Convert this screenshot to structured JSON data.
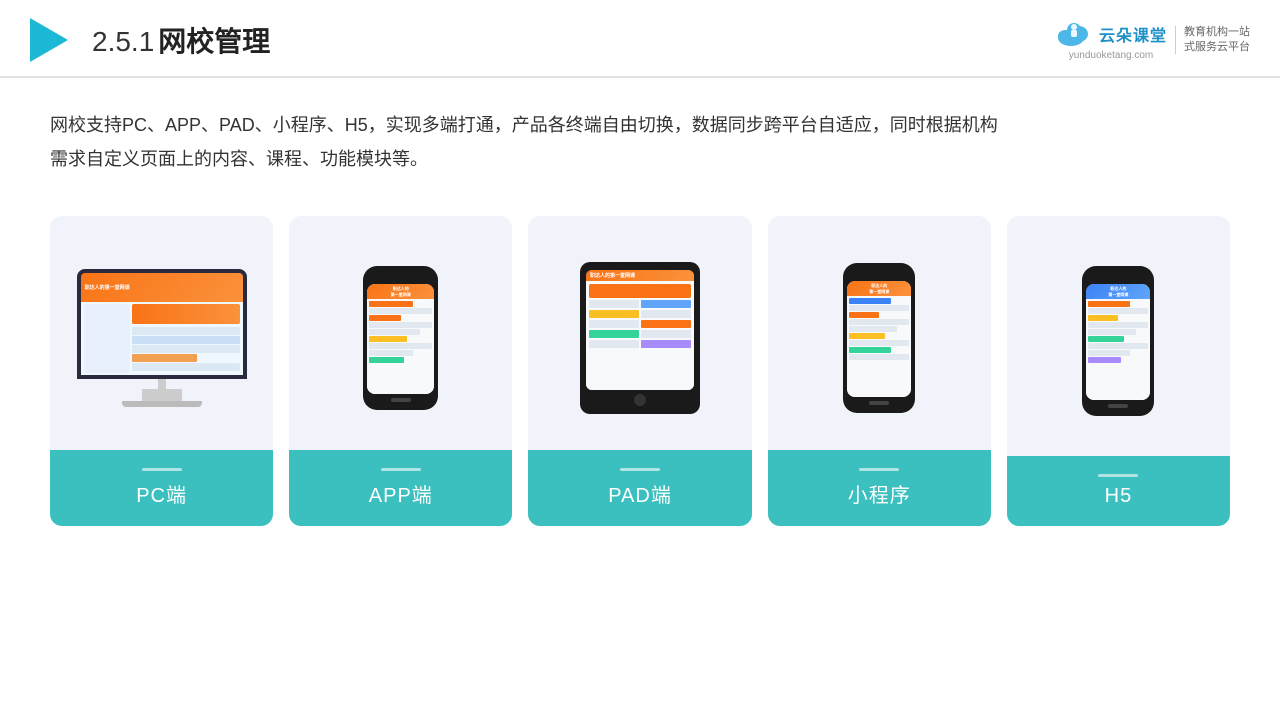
{
  "header": {
    "title_prefix": "2.5.1",
    "title_main": "网校管理",
    "logo_name": "云朵课堂",
    "logo_url": "yunduoketang.com",
    "logo_subtitle_line1": "教育机构一站",
    "logo_subtitle_line2": "式服务云平台"
  },
  "description": {
    "text_line1": "网校支持PC、APP、PAD、小程序、H5，实现多端打通，产品各终端自由切换，数据同步跨平台自适应，同时根据机构",
    "text_line2": "需求自定义页面上的内容、课程、功能模块等。"
  },
  "cards": [
    {
      "id": "pc",
      "label": "PC端"
    },
    {
      "id": "app",
      "label": "APP端"
    },
    {
      "id": "pad",
      "label": "PAD端"
    },
    {
      "id": "miniapp",
      "label": "小程序"
    },
    {
      "id": "h5",
      "label": "H5"
    }
  ]
}
